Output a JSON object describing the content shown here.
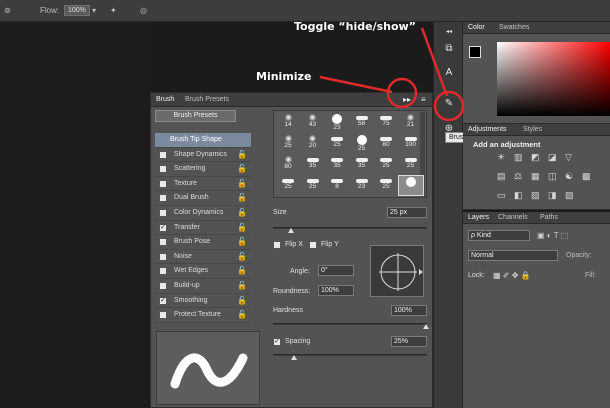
{
  "optionsbar": {
    "field_a": "Flow:",
    "field_b": "100%"
  },
  "annotations": {
    "minimize": "Minimize",
    "toggle": "Toggle “hide/show”"
  },
  "dock": {
    "tooltip": "Brush"
  },
  "brush_panel": {
    "tabs": [
      "Brush",
      "Brush Presets"
    ],
    "collapse_glyph": "▸▸",
    "menu_glyph": "≡",
    "presets_button": "Brush Presets",
    "options": [
      {
        "label": "Brush Tip Shape",
        "checked": false,
        "selected": true,
        "lock": false
      },
      {
        "label": "Shape Dynamics",
        "checked": false,
        "selected": false,
        "lock": true
      },
      {
        "label": "Scattering",
        "checked": false,
        "selected": false,
        "lock": true
      },
      {
        "label": "Texture",
        "checked": false,
        "selected": false,
        "lock": true
      },
      {
        "label": "Dual Brush",
        "checked": false,
        "selected": false,
        "lock": true
      },
      {
        "label": "Color Dynamics",
        "checked": false,
        "selected": false,
        "lock": true
      },
      {
        "label": "Transfer",
        "checked": true,
        "selected": false,
        "lock": true
      },
      {
        "label": "Brush Pose",
        "checked": false,
        "selected": false,
        "lock": true
      },
      {
        "label": "Noise",
        "checked": false,
        "selected": false,
        "lock": true
      },
      {
        "label": "Wet Edges",
        "checked": false,
        "selected": false,
        "lock": true
      },
      {
        "label": "Build-up",
        "checked": false,
        "selected": false,
        "lock": true
      },
      {
        "label": "Smoothing",
        "checked": true,
        "selected": false,
        "lock": true
      },
      {
        "label": "Protect Texture",
        "checked": false,
        "selected": false,
        "lock": true
      }
    ],
    "preset_rows": [
      [
        "14",
        "43",
        "23",
        "58",
        "75",
        "21"
      ],
      [
        "25",
        "20",
        "25",
        "25",
        "80",
        "100"
      ],
      [
        "80",
        "35",
        "35",
        "35",
        "25",
        "25"
      ],
      [
        "25",
        "25",
        "8",
        "23",
        "25",
        ""
      ]
    ],
    "size_label": "Size",
    "size_value": "25 px",
    "flipx_label": "Flip X",
    "flipy_label": "Flip Y",
    "angle_label": "Angle:",
    "angle_value": "0°",
    "roundness_label": "Roundness:",
    "roundness_value": "100%",
    "hardness_label": "Hardness",
    "hardness_value": "100%",
    "spacing_label": "Spacing",
    "spacing_value": "25%",
    "spacing_checked": true
  },
  "color_panel": {
    "tabs": [
      "Color",
      "Swatches"
    ]
  },
  "adjustments_panel": {
    "tabs": [
      "Adjustments",
      "Styles"
    ],
    "heading": "Add an adjustment"
  },
  "layers_panel": {
    "tabs": [
      "Layers",
      "Channels",
      "Paths"
    ],
    "filter": "ρ Kind",
    "blend_mode": "Normal",
    "opacity_label": "Opacity:",
    "lock_label": "Lock:",
    "fill_label": "Fill:"
  },
  "colors": {
    "annotation_red": "#e02a2a",
    "panel_bg": "#535353",
    "selected_option": "#7c8aa0"
  }
}
